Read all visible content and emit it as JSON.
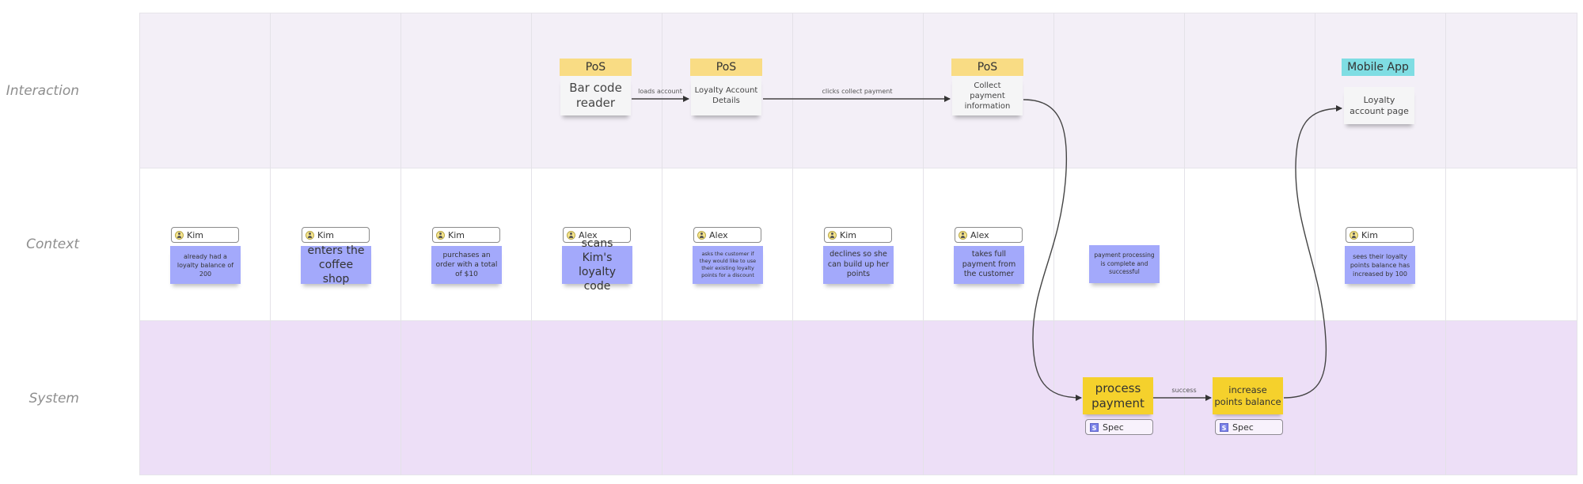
{
  "lanes": [
    {
      "id": "interaction",
      "label": "Interaction"
    },
    {
      "id": "context",
      "label": "Context"
    },
    {
      "id": "system",
      "label": "System"
    }
  ],
  "interaction": {
    "screens": [
      {
        "header": "PoS",
        "text": "Bar code reader",
        "type": "pos"
      },
      {
        "header": "PoS",
        "text": "Loyalty Account Details",
        "type": "pos"
      },
      {
        "header": "PoS",
        "text": "Collect payment information",
        "type": "pos"
      },
      {
        "header": "Mobile App",
        "text": "Loyalty account page",
        "type": "mobile"
      }
    ],
    "edges": [
      {
        "from": "Bar code reader",
        "to": "Loyalty Account Details",
        "label": "loads account"
      },
      {
        "from": "Loyalty Account Details",
        "to": "Collect payment information",
        "label": "clicks collect payment"
      }
    ]
  },
  "context": {
    "notes": [
      {
        "actor": "Kim",
        "text": "already had a loyalty balance of 200"
      },
      {
        "actor": "Kim",
        "text": "enters the coffee shop"
      },
      {
        "actor": "Kim",
        "text": "purchases an order with a total of $10"
      },
      {
        "actor": "Alex",
        "text": "scans Kim's loyalty code"
      },
      {
        "actor": "Alex",
        "text": "asks the customer if they would like to use their existing loyalty points for a discount"
      },
      {
        "actor": "Kim",
        "text": "declines so she can build up her points"
      },
      {
        "actor": "Alex",
        "text": "takes full payment from the customer"
      },
      {
        "actor": null,
        "text": "payment processing is complete and successful"
      },
      {
        "actor": "Kim",
        "text": "sees their loyalty points balance has increased by 100"
      }
    ]
  },
  "system": {
    "cards": [
      {
        "text": "process payment",
        "tag": "Spec",
        "tag_icon": "S"
      },
      {
        "text": "increase points balance",
        "tag": "Spec",
        "tag_icon": "S"
      }
    ],
    "edges": [
      {
        "from": "Collect payment information",
        "to": "process payment",
        "label": ""
      },
      {
        "from": "process payment",
        "to": "increase points balance",
        "label": "success"
      },
      {
        "from": "increase points balance",
        "to": "Loyalty account page",
        "label": ""
      }
    ]
  },
  "colors": {
    "interaction_lane": "#f3eff7",
    "context_lane": "#ffffff",
    "system_lane": "#eddff7",
    "pos_header": "#f9dc84",
    "mobile_header": "#7fdde3",
    "context_sticky": "#a3a9fb",
    "system_card": "#f5d12c"
  }
}
